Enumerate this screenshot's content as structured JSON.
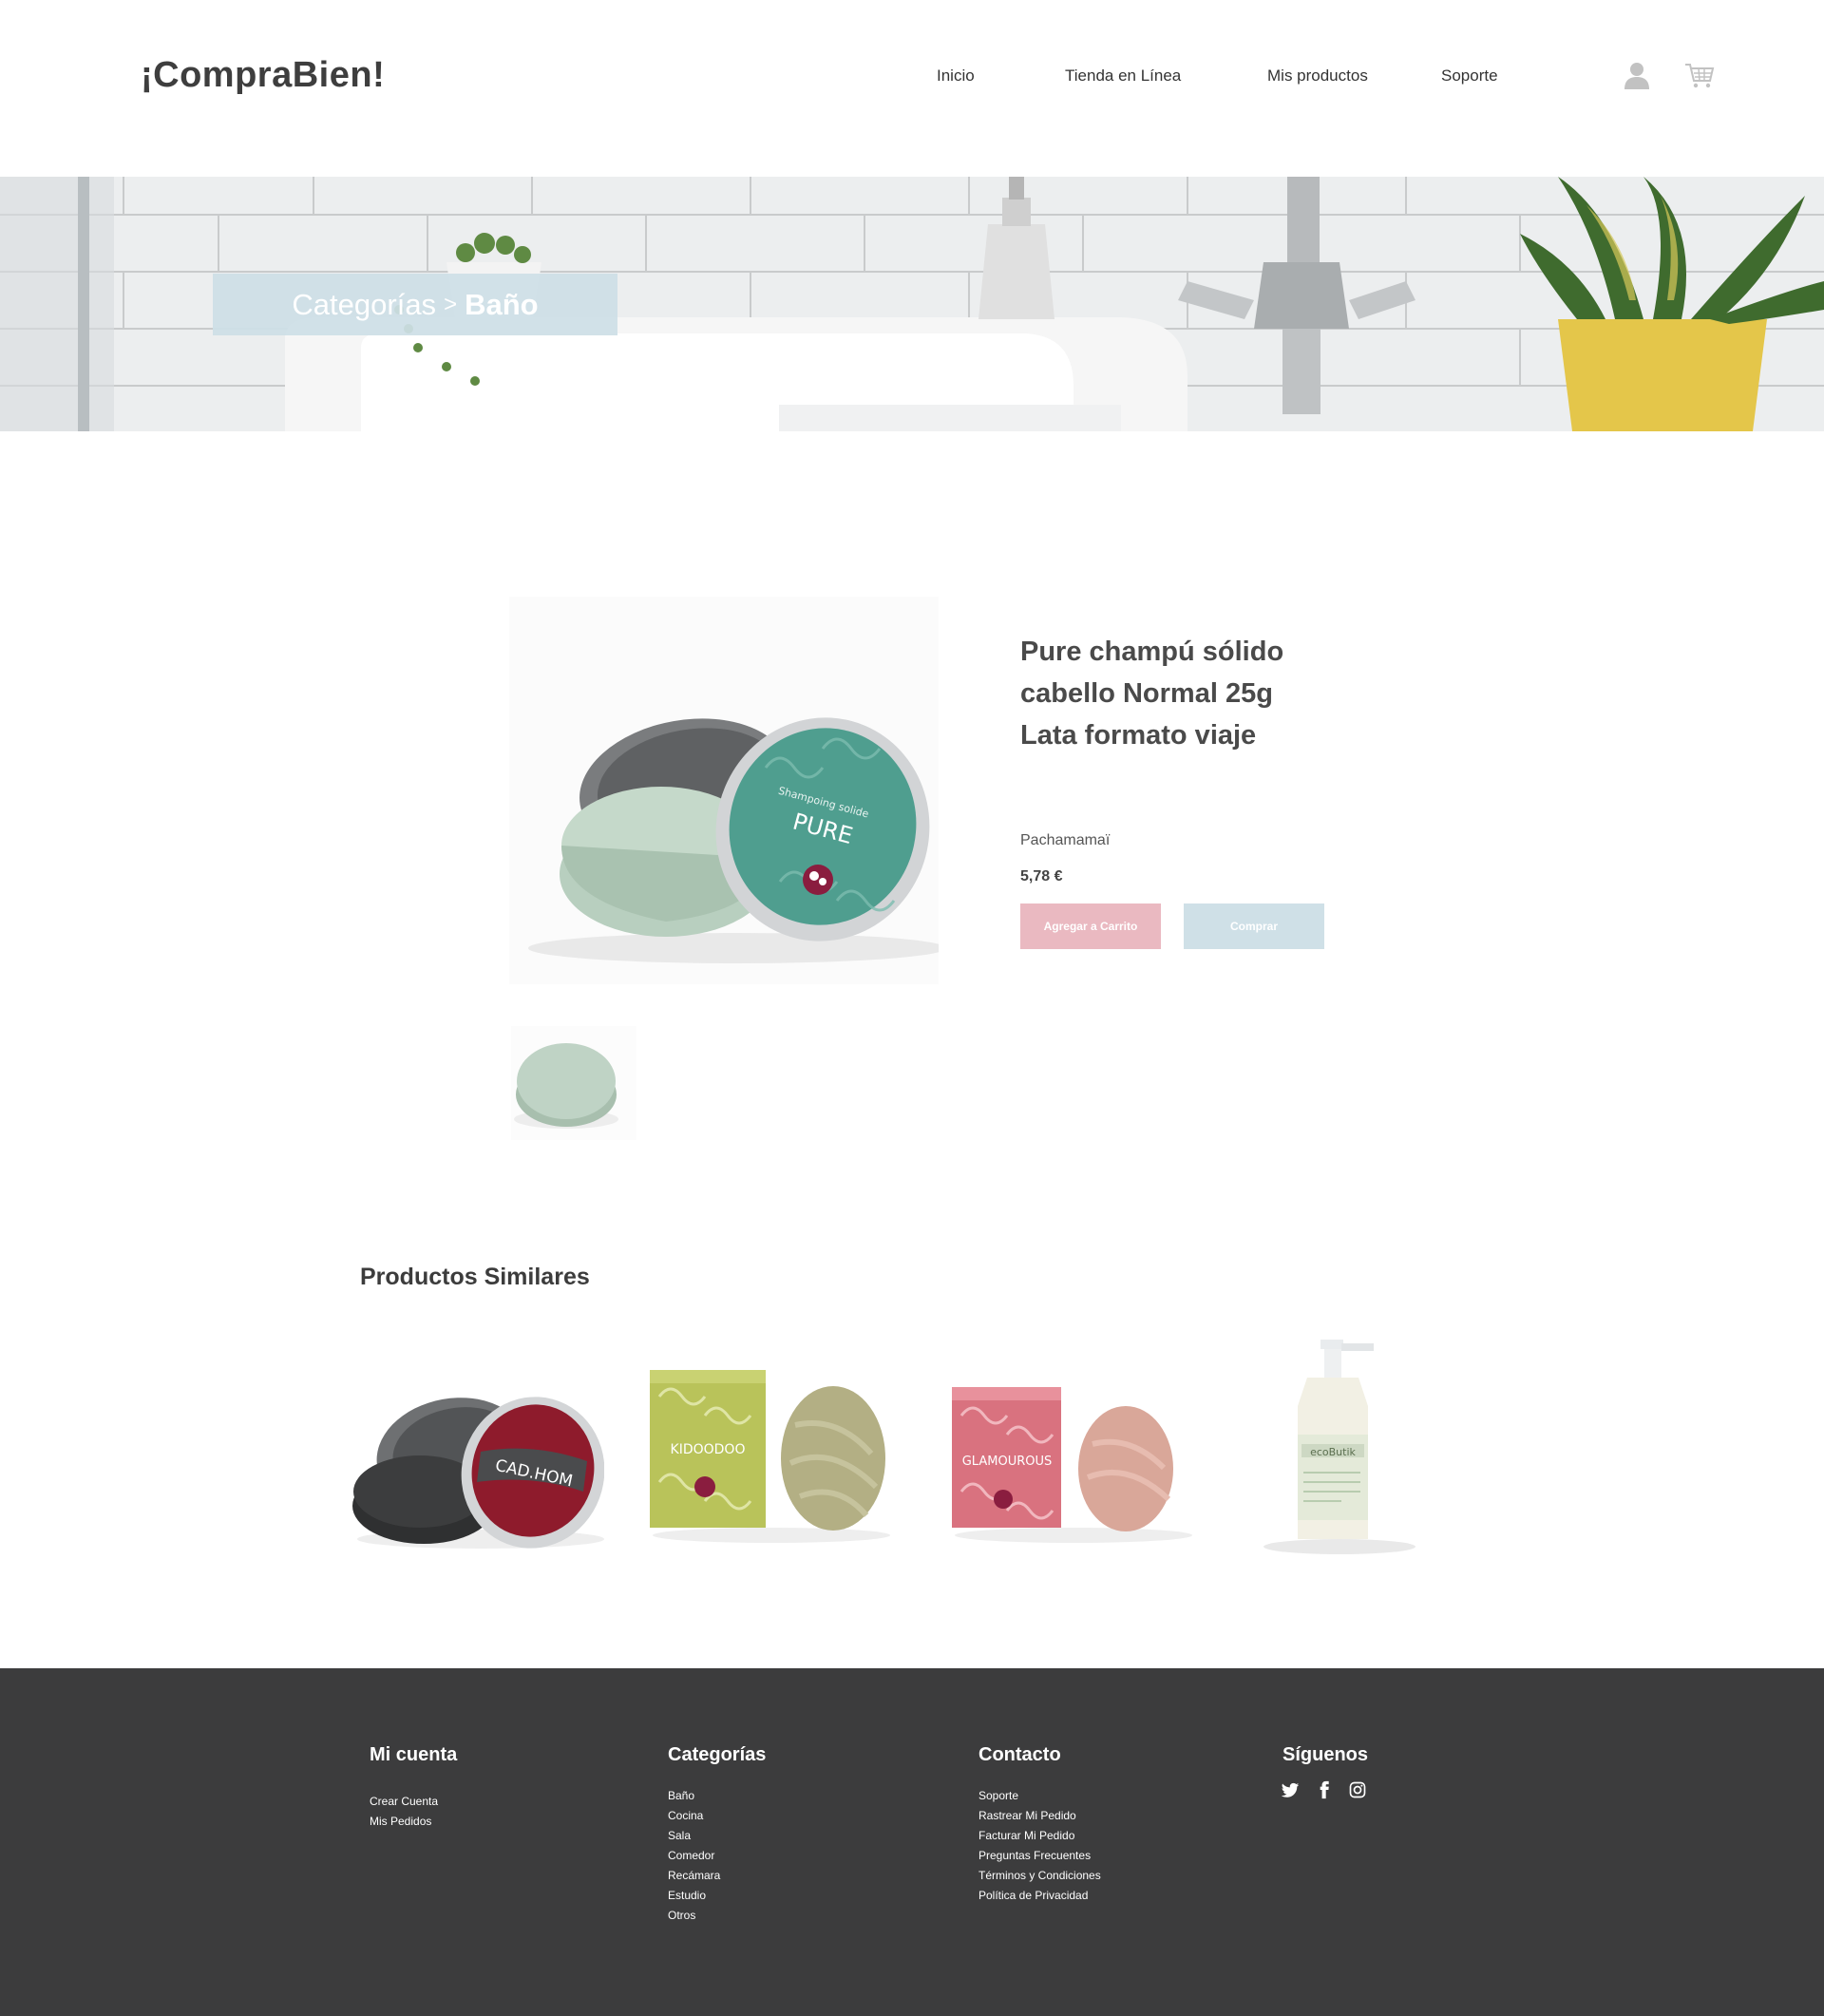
{
  "header": {
    "logo": "¡CompraBien!",
    "nav": [
      "Inicio",
      "Tienda en Línea",
      "Mis productos",
      "Soporte"
    ],
    "icons": [
      "user-icon",
      "cart-icon"
    ]
  },
  "banner": {
    "breadcrumb_parent": "Categorías",
    "breadcrumb_separator": ">",
    "breadcrumb_current": "Baño"
  },
  "product": {
    "title_lines": [
      "Pure champú sólido",
      "cabello Normal 25g",
      "Lata formato viaje"
    ],
    "brand": "Pachamamaï",
    "price": "5,78 €",
    "add_to_cart_label": "Agregar a Carrito",
    "buy_label": "Comprar",
    "tin_label_small": "Shampoing solide",
    "tin_label_big": "PURE"
  },
  "similar": {
    "title": "Productos Similares",
    "items": [
      {
        "label": "CAD.HOM"
      },
      {
        "label": "KIDOODOO"
      },
      {
        "label": "GLAMOUROUS"
      },
      {
        "label": "ecoButik"
      }
    ]
  },
  "footer": {
    "mi_cuenta": {
      "title": "Mi cuenta",
      "links": [
        "Crear Cuenta",
        "Mis Pedidos"
      ]
    },
    "categorias": {
      "title": "Categorías",
      "links": [
        "Baño",
        "Cocina",
        "Sala",
        "Comedor",
        "Recámara",
        "Estudio",
        "Otros"
      ]
    },
    "contacto": {
      "title": "Contacto",
      "links": [
        "Soporte",
        "Rastrear Mi Pedido",
        "Facturar Mi Pedido",
        "Preguntas Frecuentes",
        "Términos y Condiciones",
        "Política de Privacidad"
      ]
    },
    "siguenos": {
      "title": "Síguenos",
      "icons": [
        "twitter-icon",
        "facebook-icon",
        "instagram-icon"
      ]
    }
  },
  "colors": {
    "footer_bg": "#3c3c3d",
    "cart_button": "#eab9c1",
    "buy_button": "#cfe0e7",
    "breadcrumb_bg": "#cddfe6"
  }
}
